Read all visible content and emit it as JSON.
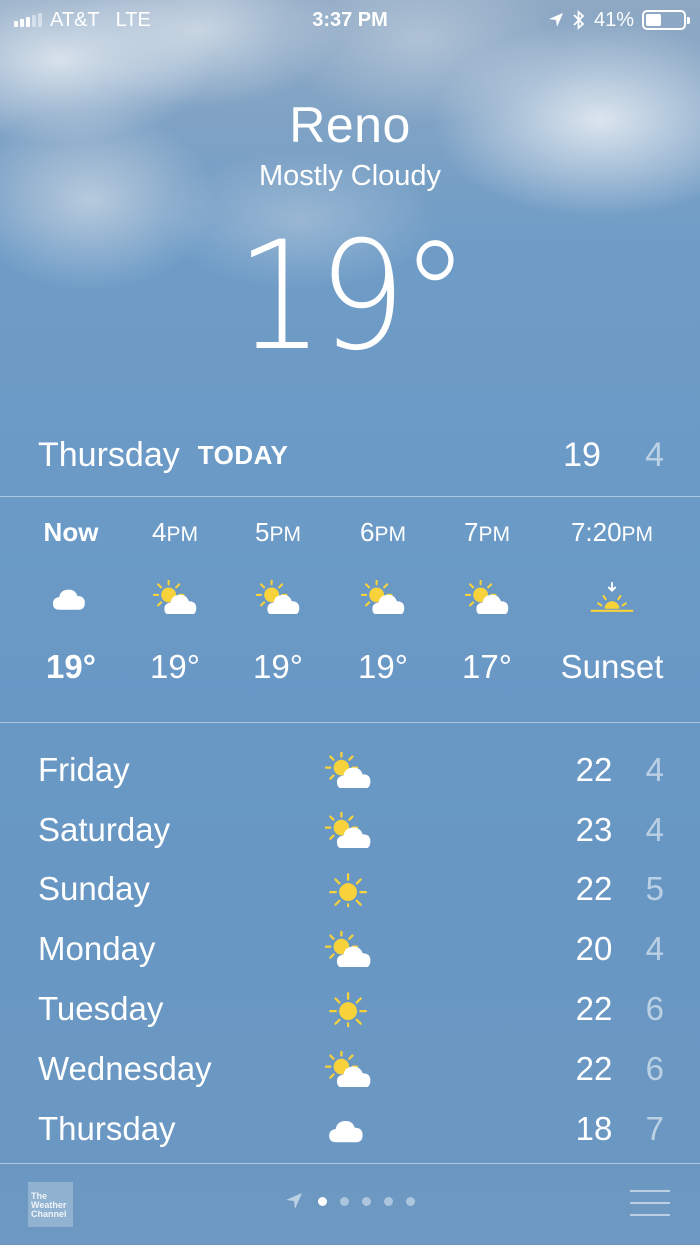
{
  "status": {
    "carrier": "AT&T",
    "network": "LTE",
    "time": "3:37 PM",
    "battery": "41%",
    "battery_level": 0.41
  },
  "location": {
    "city": "Reno",
    "condition": "Mostly Cloudy",
    "current_temp": "19°"
  },
  "today": {
    "day": "Thursday",
    "tag": "TODAY",
    "high": "19",
    "low": "4"
  },
  "hourly": [
    {
      "time": "Now",
      "icon": "cloud-icon",
      "temp": "19°"
    },
    {
      "time": "4PM",
      "icon": "partly-sunny-icon",
      "temp": "19°"
    },
    {
      "time": "5PM",
      "icon": "partly-sunny-icon",
      "temp": "19°"
    },
    {
      "time": "6PM",
      "icon": "partly-sunny-icon",
      "temp": "19°"
    },
    {
      "time": "7PM",
      "icon": "partly-sunny-icon",
      "temp": "17°"
    },
    {
      "time": "7:20PM",
      "icon": "sunset-icon",
      "temp": "Sunset"
    }
  ],
  "daily": [
    {
      "day": "Friday",
      "icon": "partly-sunny-icon",
      "high": "22",
      "low": "4"
    },
    {
      "day": "Saturday",
      "icon": "partly-sunny-icon",
      "high": "23",
      "low": "4"
    },
    {
      "day": "Sunday",
      "icon": "sun-icon",
      "high": "22",
      "low": "5"
    },
    {
      "day": "Monday",
      "icon": "partly-sunny-icon",
      "high": "20",
      "low": "4"
    },
    {
      "day": "Tuesday",
      "icon": "sun-icon",
      "high": "22",
      "low": "6"
    },
    {
      "day": "Wednesday",
      "icon": "partly-sunny-icon",
      "high": "22",
      "low": "6"
    },
    {
      "day": "Thursday",
      "icon": "cloud-icon",
      "high": "18",
      "low": "7"
    }
  ],
  "footer": {
    "logo_text": [
      "The",
      "Weather",
      "Channel"
    ],
    "page_count": 5,
    "active_page": 0
  },
  "colors": {
    "sun": "#f7d23a",
    "text": "#ffffff"
  }
}
